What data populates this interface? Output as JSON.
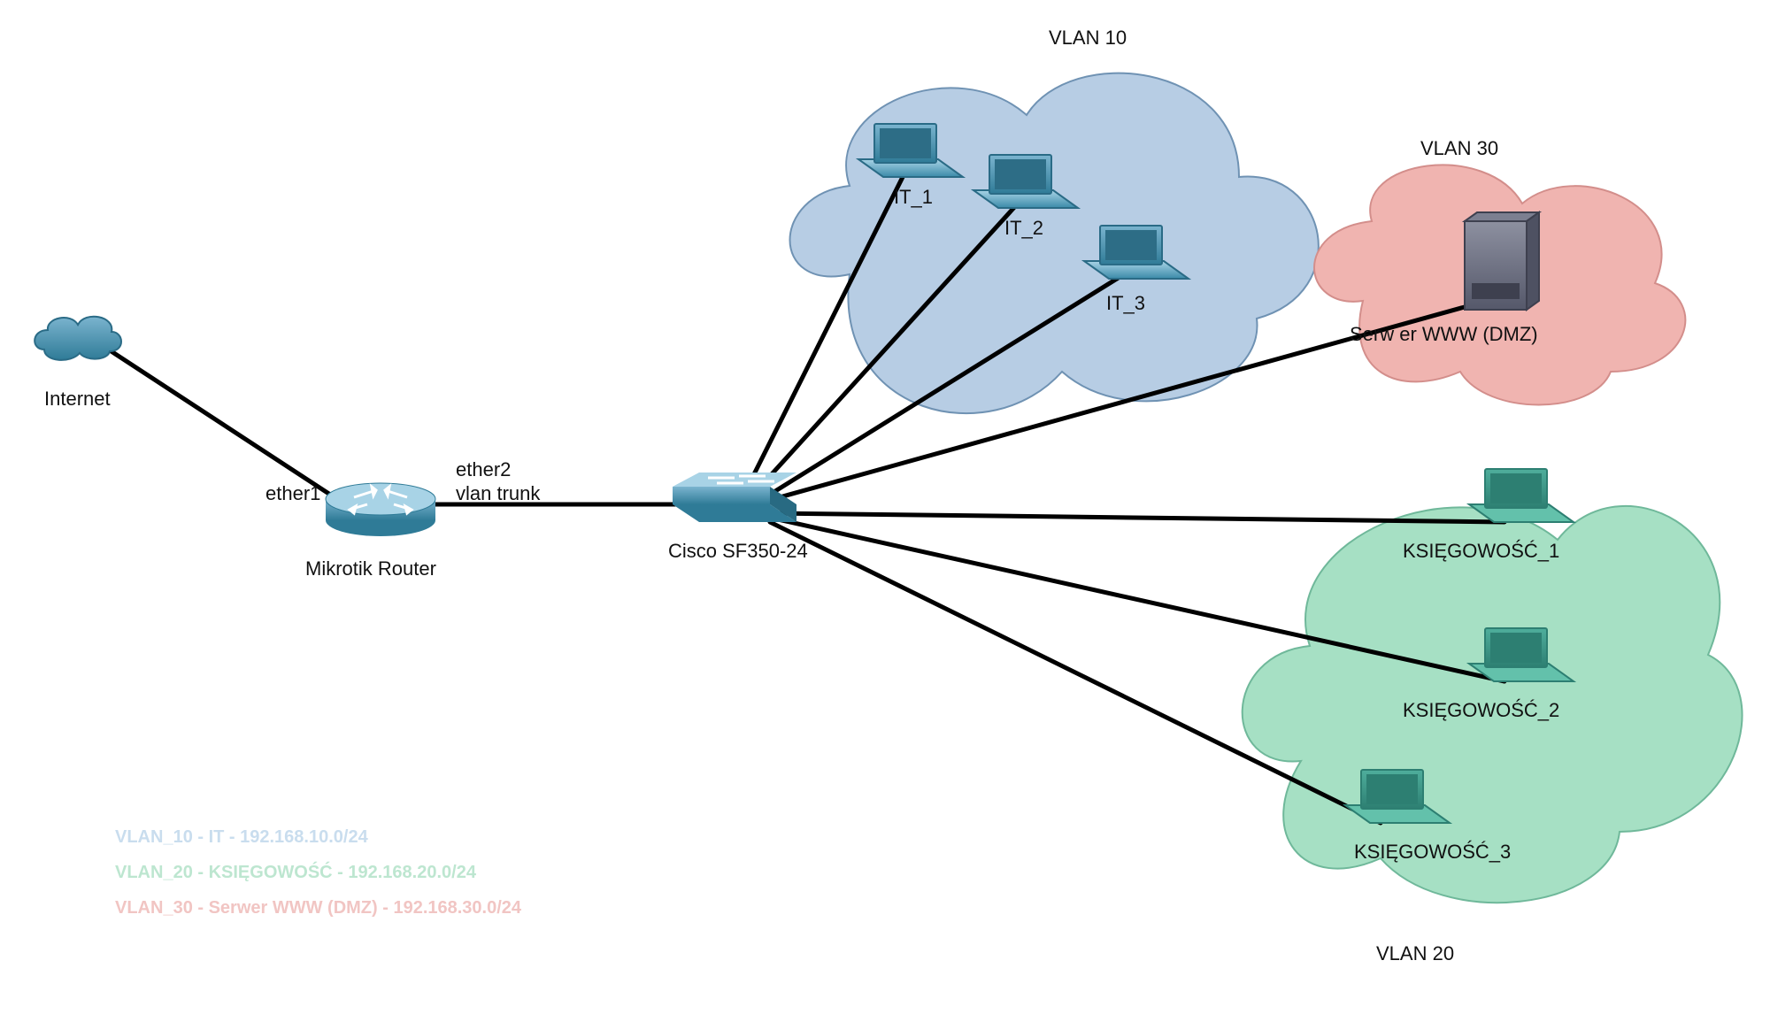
{
  "nodes": {
    "internet": {
      "label": "Internet"
    },
    "router": {
      "label": "Mikrotik Router",
      "port_wan": "ether1",
      "port_lan": "ether2",
      "port_lan_sub": "vlan trunk"
    },
    "switch": {
      "label": "Cisco SF350-24"
    }
  },
  "vlans": {
    "v10": {
      "title": "VLAN 10",
      "members": [
        "IT_1",
        "IT_2",
        "IT_3"
      ]
    },
    "v20": {
      "title": "VLAN 20",
      "members": [
        "KSIĘGOWOŚĆ_1",
        "KSIĘGOWOŚĆ_2",
        "KSIĘGOWOŚĆ_3"
      ]
    },
    "v30": {
      "title": "VLAN 30",
      "server": "Serw er WWW (DMZ)"
    }
  },
  "legend": {
    "line1": "VLAN_10 - IT - 192.168.10.0/24",
    "line2": "VLAN_20 - KSIĘGOWOŚĆ - 192.168.20.0/24",
    "line3": "VLAN_30 - Serwer WWW (DMZ) - 192.168.30.0/24"
  },
  "colors": {
    "cloud_blue": "#b7cde4",
    "cloud_green": "#a6e0c4",
    "cloud_pink": "#f0b4b0",
    "dev_body": "#3b8aa8",
    "dev_body2": "#2f7b97",
    "server_body": "#6f7280",
    "cloud_stroke": "#6f92b3",
    "link": "#000"
  }
}
